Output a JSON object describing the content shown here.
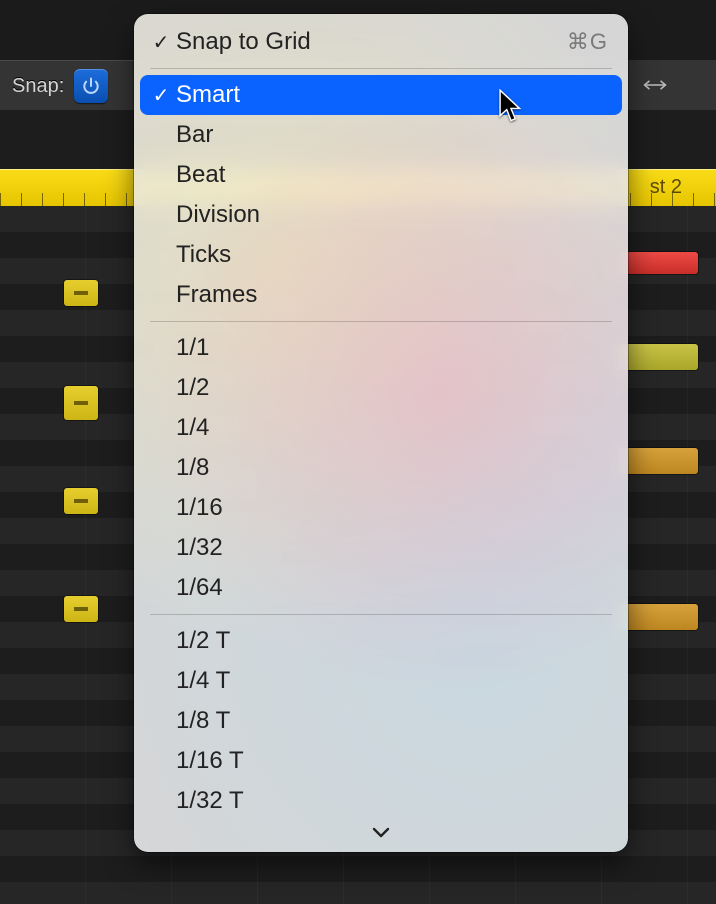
{
  "toolbar": {
    "snap_label": "Snap:"
  },
  "ruler": {
    "marker_label": "st 2"
  },
  "menu": {
    "header": {
      "label": "Snap to Grid",
      "shortcut": "⌘G",
      "checked": true
    },
    "groups": [
      {
        "items": [
          {
            "label": "Smart",
            "checked": true,
            "selected": true
          },
          {
            "label": "Bar"
          },
          {
            "label": "Beat"
          },
          {
            "label": "Division"
          },
          {
            "label": "Ticks"
          },
          {
            "label": "Frames"
          }
        ]
      },
      {
        "items": [
          {
            "label": "1/1"
          },
          {
            "label": "1/2"
          },
          {
            "label": "1/4"
          },
          {
            "label": "1/8"
          },
          {
            "label": "1/16"
          },
          {
            "label": "1/32"
          },
          {
            "label": "1/64"
          }
        ]
      },
      {
        "items": [
          {
            "label": "1/2 T"
          },
          {
            "label": "1/4 T"
          },
          {
            "label": "1/8 T"
          },
          {
            "label": "1/16 T"
          },
          {
            "label": "1/32 T"
          }
        ]
      }
    ]
  }
}
